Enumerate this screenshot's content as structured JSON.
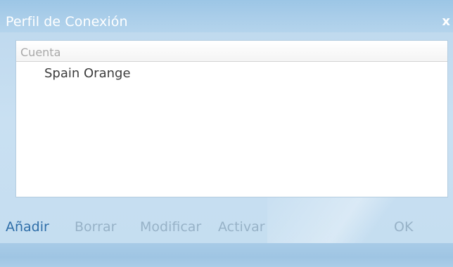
{
  "window": {
    "title": "Perfil de Conexión",
    "close_label": "x"
  },
  "list": {
    "column_header": "Cuenta",
    "items": [
      {
        "label": "Spain Orange"
      }
    ]
  },
  "actions": {
    "add": {
      "label": "Añadir",
      "enabled": true
    },
    "delete": {
      "label": "Borrar",
      "enabled": false
    },
    "modify": {
      "label": "Modificar",
      "enabled": false
    },
    "activate": {
      "label": "Activar",
      "enabled": false
    },
    "ok": {
      "label": "OK",
      "enabled": false
    }
  },
  "colors": {
    "title_bg": "#9cc6e6",
    "window_bg": "#c4ddf0",
    "enabled_text": "#2f6ea8",
    "disabled_text": "#97b2c7"
  }
}
